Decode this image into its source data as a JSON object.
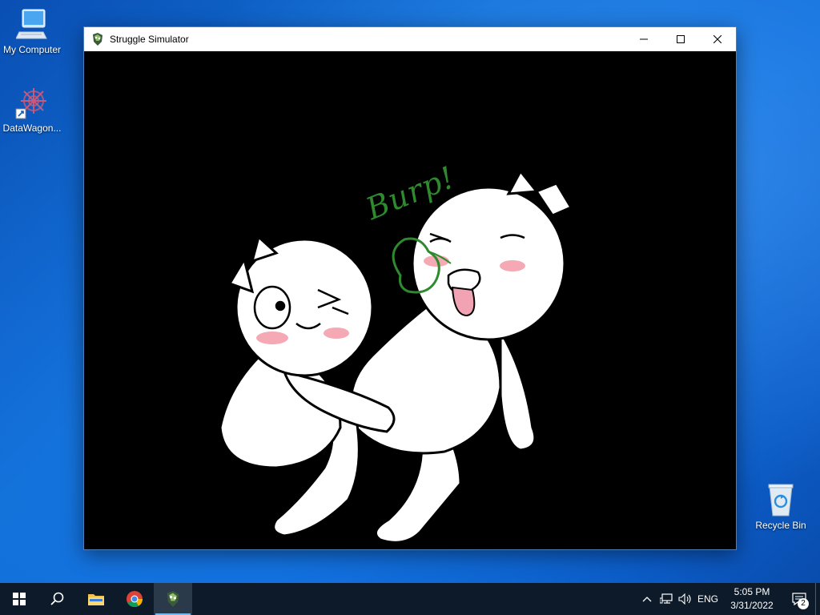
{
  "desktop": {
    "icons": [
      {
        "label": "My Computer",
        "icon": "computer-icon"
      },
      {
        "label": "DataWagon...",
        "icon": "datawagon-app-icon"
      },
      {
        "label": "Recycle Bin",
        "icon": "recycle-bin-icon"
      }
    ]
  },
  "window": {
    "title": "Struggle Simulator",
    "app_icon": "struggle-simulator-icon",
    "content": {
      "scene_text": "Burp!"
    },
    "controls": [
      "minimize-icon",
      "maximize-icon",
      "close-icon"
    ]
  },
  "taskbar": {
    "pinned": [
      {
        "name": "start-button",
        "icon": "windows-logo-icon"
      },
      {
        "name": "search-button",
        "icon": "search-icon"
      },
      {
        "name": "file-explorer-button",
        "icon": "folder-icon"
      },
      {
        "name": "chrome-button",
        "icon": "chrome-icon"
      },
      {
        "name": "struggle-simulator-task",
        "icon": "struggle-simulator-icon",
        "active": true
      }
    ],
    "tray": {
      "lang": "ENG",
      "time": "5:05 PM",
      "date": "3/31/2022",
      "notification_count": "2"
    }
  },
  "colors": {
    "accent": "#76b9ed",
    "taskbar": "#0c1a2a",
    "burp_green": "#2f8a2f",
    "blush": "#f4a9b4"
  }
}
